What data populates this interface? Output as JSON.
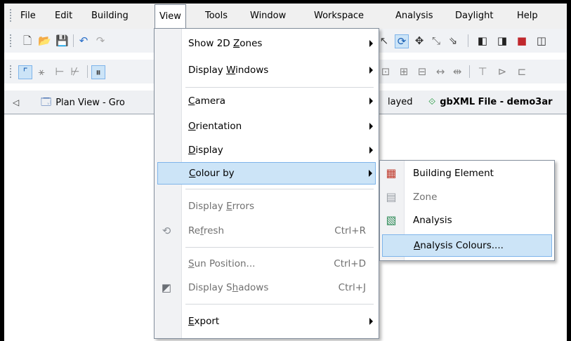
{
  "menubar": {
    "items": [
      "File",
      "Edit",
      "Building",
      "View",
      "Tools",
      "Window",
      "Workspace",
      "Analysis",
      "Daylight",
      "Help"
    ]
  },
  "tabs": {
    "nav_arrow": "◁",
    "plan_view": "Plan View - Gro",
    "displayed_fragment": "layed",
    "gbxml": "gbXML File - demo3ar"
  },
  "view_menu": {
    "show_2d_zones": "Show 2D Zones",
    "display_windows": "Display Windows",
    "camera": "Camera",
    "orientation": "Orientation",
    "display": "Display",
    "colour_by": "Colour by",
    "display_errors": "Display Errors",
    "refresh": "Refresh",
    "refresh_shortcut": "Ctrl+R",
    "sun_position": "Sun Position...",
    "sun_position_shortcut": "Ctrl+D",
    "display_shadows": "Display Shadows",
    "display_shadows_shortcut": "Ctrl+J",
    "export": "Export"
  },
  "colour_by_menu": {
    "building_element": "Building Element",
    "zone": "Zone",
    "analysis": "Analysis",
    "analysis_colours": "Analysis Colours...."
  },
  "colors": {
    "highlight": "#cce4f7",
    "highlight_border": "#7eb4ea",
    "disabled_text": "#707070"
  }
}
